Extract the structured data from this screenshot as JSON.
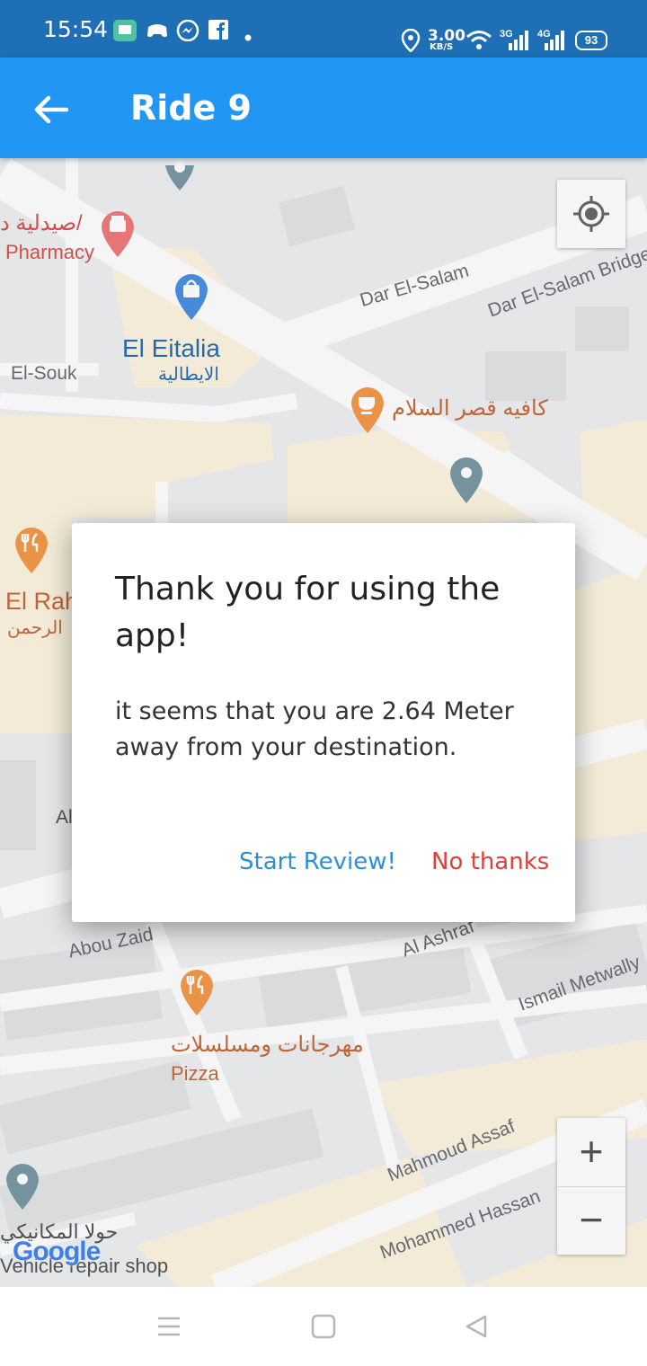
{
  "status_bar": {
    "time": "15:54",
    "net_speed": "3.00",
    "net_unit": "KB/S",
    "sig1": "3G",
    "sig2": "4G",
    "battery": "93"
  },
  "app_bar": {
    "title": "Ride 9",
    "back_icon": "arrow-left-icon"
  },
  "map": {
    "labels": {
      "pharmacy_ar": "صيدلية د/",
      "pharmacy": "Pharmacy",
      "el_eitalia": "El Eitalia",
      "el_eitalia_ar": "الايطالية",
      "el_souk": "El-Souk",
      "dar_el_salam": "Dar El-Salam",
      "dar_el_salam_bridge": "Dar El-Salam Bridge",
      "cafe_ar": "كافيه قصر السلام",
      "el_rah": "El Rah",
      "el_rah_ar": "الرحمن",
      "al_left": "Al",
      "abou_zaid": "Abou Zaid",
      "al_ashraf": "Al Ashraf",
      "ismail_metwally": "Ismail Metwally",
      "pizza_ar": "مهرجانات ومسلسلات",
      "pizza": "Pizza",
      "mahmoud_assaf": "Mahmoud Assaf",
      "mohammed_hassan": "Mohammed Hassan",
      "repair_ar": "حولا المكانيكي",
      "repair": "Vehicle repair shop",
      "google": "Google"
    },
    "zoom_in": "+",
    "zoom_out": "−",
    "my_location_icon": "crosshair-location-icon"
  },
  "dialog": {
    "title": "Thank you for using the app!",
    "message": "it seems that you are 2.64 Meter away from your destination.",
    "positive": "Start Review!",
    "negative": "No thanks"
  },
  "colors": {
    "status_bar": "#1e6fb5",
    "app_bar": "#2196f3",
    "positive": "#2e8fd6",
    "negative": "#e0403a"
  },
  "nav_bar": {
    "icons": [
      "menu-icon",
      "home-square-icon",
      "back-triangle-icon"
    ]
  }
}
